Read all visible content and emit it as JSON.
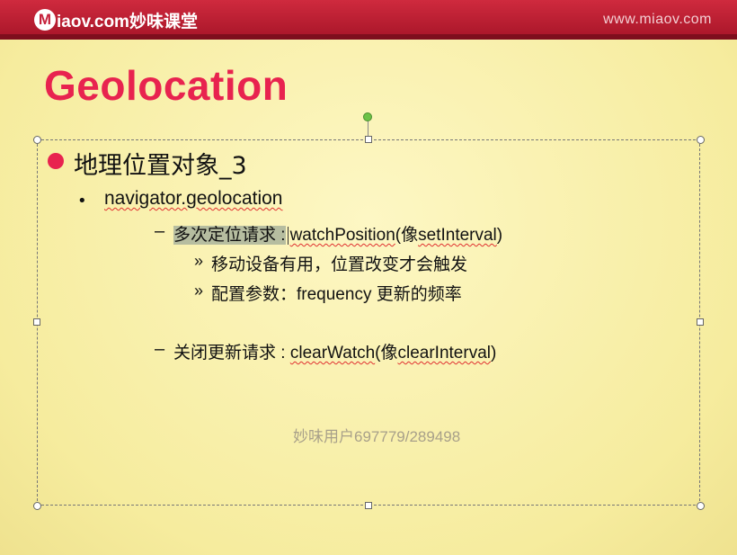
{
  "header": {
    "logo_mark": "M",
    "logo_text": "iaov.com妙味课堂",
    "site_url": "www.miaov.com"
  },
  "slide": {
    "title": "Geolocation",
    "level1": "地理位置对象_3",
    "level2": "navigator.geolocation",
    "item1": {
      "dash": "–",
      "label": "多次定位请求 :",
      "method": "watchPosition",
      "paren_open": "(像",
      "analog": "setInterval",
      "paren_close": ")"
    },
    "sub": [
      {
        "mark": "»",
        "text": "移动设备有用，位置改变才会触发"
      },
      {
        "mark": "»",
        "text": "配置参数：frequency 更新的频率"
      }
    ],
    "item2": {
      "dash": "–",
      "label": "关闭更新请求 : ",
      "method": "clearWatch",
      "paren_open": "(像",
      "analog": "clearInterval",
      "paren_close": ")"
    },
    "watermark": "妙味用户697779/289498"
  },
  "colors": {
    "header_red": "#c01f33",
    "title_pink": "#e8234f",
    "slide_yellow": "#f9f0a8"
  }
}
